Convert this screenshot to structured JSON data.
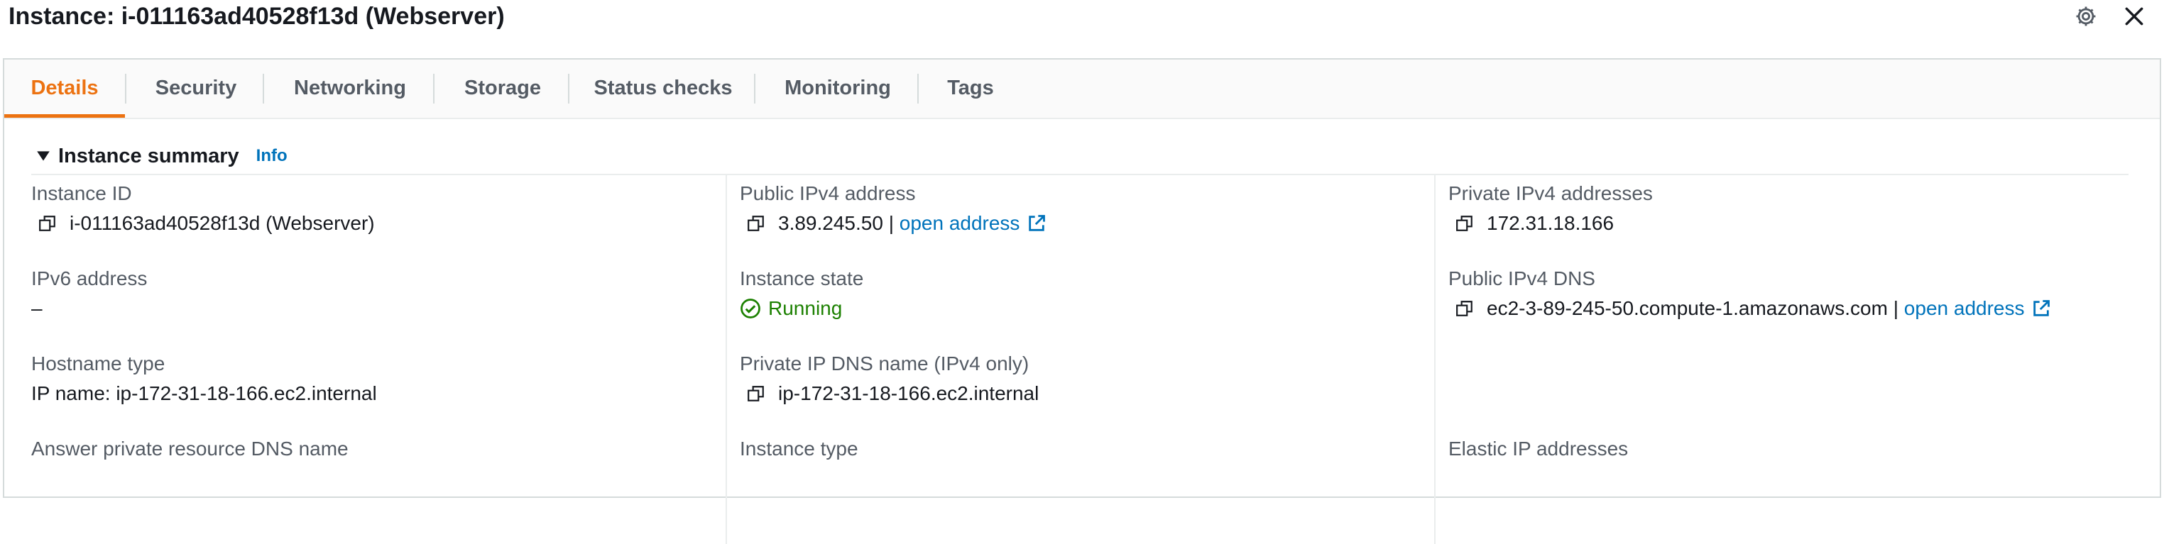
{
  "header": {
    "title": "Instance: i-011163ad40528f13d (Webserver)",
    "settings_icon": "gear-icon",
    "close_icon": "close-icon"
  },
  "tabs": [
    {
      "label": "Details",
      "active": true
    },
    {
      "label": "Security",
      "active": false
    },
    {
      "label": "Networking",
      "active": false
    },
    {
      "label": "Storage",
      "active": false
    },
    {
      "label": "Status checks",
      "active": false
    },
    {
      "label": "Monitoring",
      "active": false
    },
    {
      "label": "Tags",
      "active": false
    }
  ],
  "summary": {
    "title": "Instance summary",
    "info_link": "Info",
    "expanded": true
  },
  "fields": {
    "instance_id": {
      "label": "Instance ID",
      "value": "i-011163ad40528f13d (Webserver)"
    },
    "public_ipv4": {
      "label": "Public IPv4 address",
      "value": "3.89.245.50 |",
      "link": "open address"
    },
    "private_ipv4": {
      "label": "Private IPv4 addresses",
      "value": "172.31.18.166"
    },
    "ipv6": {
      "label": "IPv6 address",
      "value": "–"
    },
    "instance_state": {
      "label": "Instance state",
      "value": "Running"
    },
    "public_dns": {
      "label": "Public IPv4 DNS",
      "value": "ec2-3-89-245-50.compute-1.amazonaws.com |",
      "link": "open address"
    },
    "hostname_type": {
      "label": "Hostname type",
      "value": "IP name: ip-172-31-18-166.ec2.internal"
    },
    "private_dns": {
      "label": "Private IP DNS name (IPv4 only)",
      "value": "ip-172-31-18-166.ec2.internal"
    },
    "answer_dns": {
      "label": "Answer private resource DNS name"
    },
    "instance_type": {
      "label": "Instance type"
    },
    "elastic_ip": {
      "label": "Elastic IP addresses"
    }
  },
  "colors": {
    "accent": "#ec7211",
    "link": "#0073bb",
    "success": "#1d8102"
  }
}
